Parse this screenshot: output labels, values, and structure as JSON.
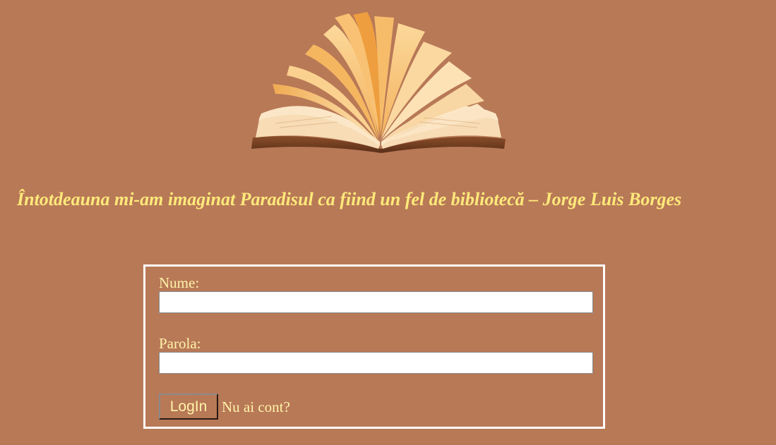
{
  "header": {
    "image": "open-book-illustration"
  },
  "quote": {
    "text": "Întotdeauna mi-am imaginat Paradisul ca fiind un fel de bibliotecă – Jorge Luis Borges"
  },
  "login_form": {
    "username_label": "Nume:",
    "username_value": "",
    "password_label": "Parola:",
    "password_value": "",
    "submit_label": "LogIn",
    "signup_link": "Nu ai cont?"
  },
  "colors": {
    "background": "#b87957",
    "quote_text": "#ffe97a",
    "form_text": "#fff3a8",
    "form_border": "#ffffff"
  }
}
